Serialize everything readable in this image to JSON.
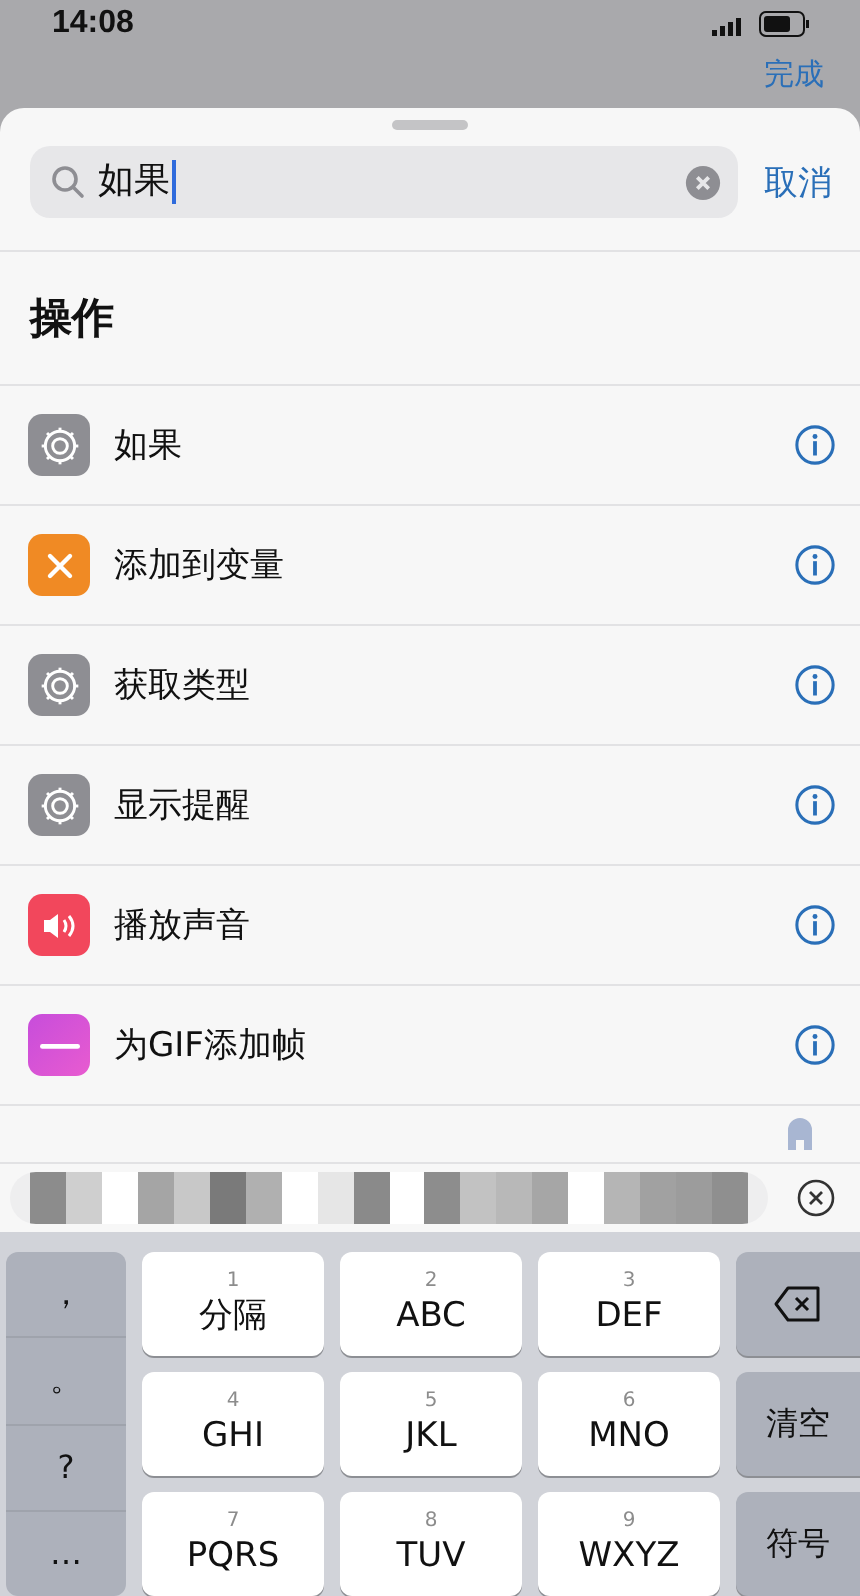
{
  "status_bar": {
    "time": "14:08"
  },
  "background_button": "完成",
  "search": {
    "value": "如果",
    "cancel": "取消"
  },
  "section_title": "操作",
  "actions": [
    {
      "label": "如果",
      "kind": "gear"
    },
    {
      "label": "添加到变量",
      "kind": "variable"
    },
    {
      "label": "获取类型",
      "kind": "gear"
    },
    {
      "label": "显示提醒",
      "kind": "gear"
    },
    {
      "label": "播放声音",
      "kind": "sound"
    },
    {
      "label": "为GIF添加帧",
      "kind": "gif"
    }
  ],
  "keyboard": {
    "left_keys": [
      "，",
      "。",
      "?",
      "…"
    ],
    "keys": [
      {
        "digit": "1",
        "label": "分隔"
      },
      {
        "digit": "2",
        "label": "ABC"
      },
      {
        "digit": "3",
        "label": "DEF"
      },
      {
        "digit": "4",
        "label": "GHI"
      },
      {
        "digit": "5",
        "label": "JKL"
      },
      {
        "digit": "6",
        "label": "MNO"
      },
      {
        "digit": "7",
        "label": "PQRS"
      },
      {
        "digit": "8",
        "label": "TUV"
      },
      {
        "digit": "9",
        "label": "WXYZ"
      }
    ],
    "right_keys": [
      {
        "kind": "delete"
      },
      {
        "kind": "text",
        "label": "清空"
      },
      {
        "kind": "text",
        "label": "符号"
      }
    ]
  }
}
